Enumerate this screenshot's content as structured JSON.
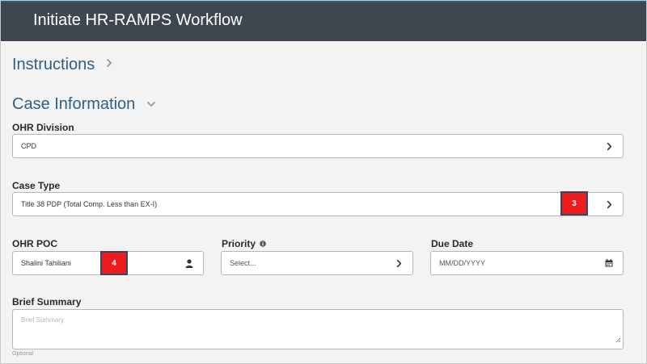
{
  "header": {
    "title": "Initiate HR-RAMPS Workflow"
  },
  "sections": {
    "instructions": {
      "label": "Instructions",
      "chevron": "chevron-right-icon"
    },
    "case_information": {
      "label": "Case Information",
      "chevron": "chevron-down-icon"
    }
  },
  "fields": {
    "ohr_division": {
      "label": "OHR Division",
      "value": "CPD",
      "icon": "chevron-right-icon"
    },
    "case_type": {
      "label": "Case Type",
      "value": "Title 38 PDP (Total Comp. Less than EX-I)",
      "icon": "chevron-right-icon"
    },
    "ohr_poc": {
      "label": "OHR POC",
      "value": "Shalini Tahiliani",
      "icon": "person-icon"
    },
    "priority": {
      "label": "Priority",
      "placeholder": "Select...",
      "icon": "chevron-right-icon",
      "info_icon": "info-icon"
    },
    "due_date": {
      "label": "Due Date",
      "placeholder": "MM/DD/YYYY",
      "icon": "calendar-icon"
    },
    "brief_summary": {
      "label": "Brief Summary",
      "placeholder": "Brief Summary",
      "hint": "Optional"
    }
  },
  "annotations": [
    {
      "text": "3",
      "color": "#ee1c1c"
    },
    {
      "text": "4",
      "color": "#ee1c1c"
    }
  ]
}
